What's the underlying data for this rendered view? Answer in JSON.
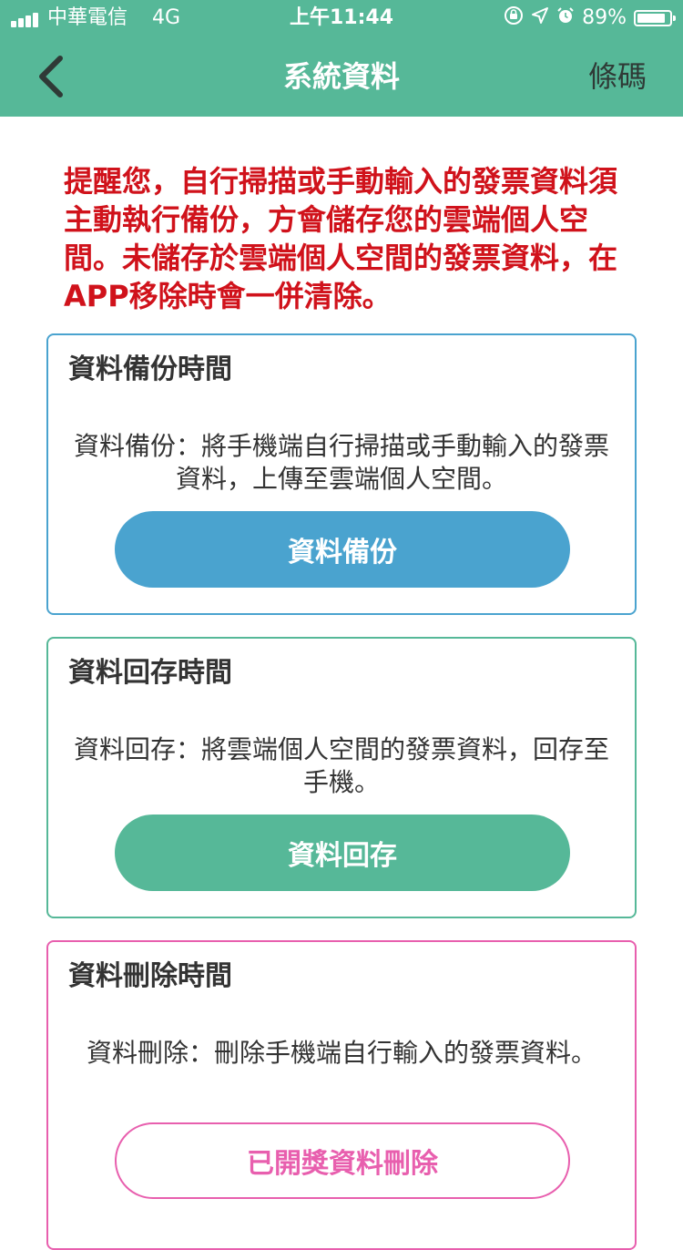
{
  "colors": {
    "header": "#56b898",
    "reminder_text": "#d0121b",
    "backup_accent": "#4aa3cf",
    "restore_accent": "#56b898",
    "delete_accent": "#e85fae"
  },
  "status_bar": {
    "carrier": "中華電信",
    "network": "4G",
    "time": "上午11:44",
    "battery": "89%",
    "battery_level": 0.89,
    "icons": [
      "signal-icon",
      "orientation-lock-icon",
      "location-icon",
      "alarm-icon",
      "battery-icon"
    ]
  },
  "nav": {
    "back_icon": "chevron-left-icon",
    "title": "系統資料",
    "right_label": "條碼"
  },
  "reminder": "提醒您，自行掃描或手動輸入的發票資料須主動執行備份，方會儲存您的雲端個人空間。未儲存於雲端個人空間的發票資料，在APP移除時會一併清除。",
  "cards": {
    "backup": {
      "title": "資料備份時間",
      "description": "資料備份：將手機端自行掃描或手動輸入的發票資料，上傳至雲端個人空間。",
      "button": "資料備份"
    },
    "restore": {
      "title": "資料回存時間",
      "description": "資料回存：將雲端個人空間的發票資料，回存至手機。",
      "button": "資料回存"
    },
    "delete": {
      "title": "資料刪除時間",
      "description": "資料刪除：刪除手機端自行輸入的發票資料。",
      "button": "已開獎資料刪除"
    }
  }
}
